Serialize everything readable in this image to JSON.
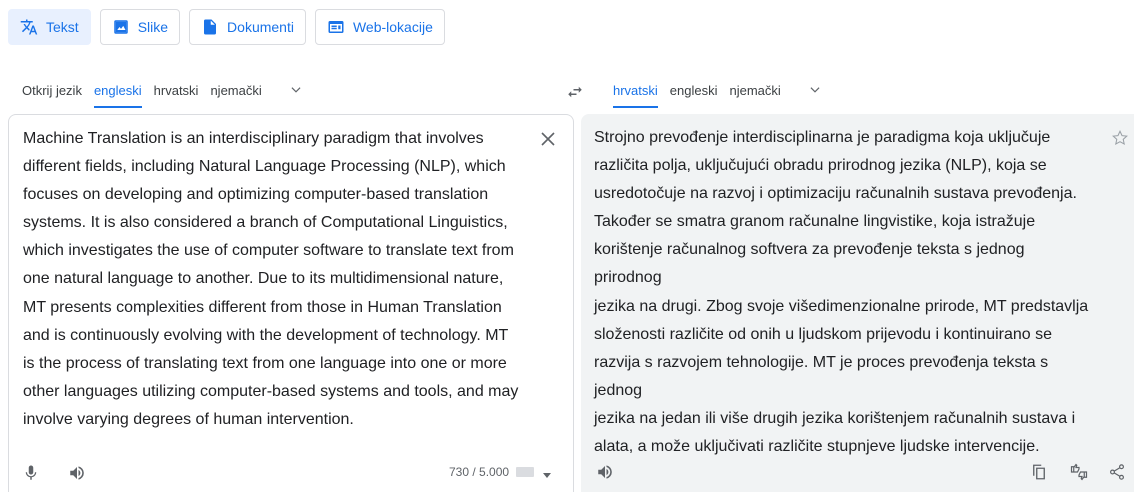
{
  "modes": [
    {
      "label": "Tekst",
      "icon": "translate-icon",
      "active": true
    },
    {
      "label": "Slike",
      "icon": "image-icon",
      "active": false
    },
    {
      "label": "Dokumenti",
      "icon": "document-icon",
      "active": false
    },
    {
      "label": "Web-lokacije",
      "icon": "website-icon",
      "active": false
    }
  ],
  "source_langs": [
    "Otkrij jezik",
    "engleski",
    "hrvatski",
    "njemački"
  ],
  "source_active": "engleski",
  "target_langs": [
    "hrvatski",
    "engleski",
    "njemački"
  ],
  "target_active": "hrvatski",
  "source": {
    "lines": [
      "Machine Translation is an interdisciplinary paradigm that involves",
      "different fields, including Natural Language Processing (NLP), which",
      "focuses on developing and optimizing computer-based translation",
      "systems. It is also considered a branch of Computational Linguistics,",
      "which investigates the use of computer software to translate text from",
      "one natural language to another. Due to its multidimensional nature,",
      "MT presents complexities different from those in Human Translation",
      "and is continuously evolving with the development of technology. MT",
      "is the process of translating text from one language into one or more",
      "other languages utilizing computer-based systems and tools, and may",
      "involve varying degrees of human intervention."
    ],
    "char_count": "730 / 5.000"
  },
  "target": {
    "lines": [
      "Strojno prevođenje interdisciplinarna je paradigma koja uključuje",
      "različita polja, uključujući obradu prirodnog jezika (NLP), koja se",
      "usredotočuje na razvoj i optimizaciju računalnih sustava prevođenja.",
      "Također se smatra granom računalne lingvistike, koja istražuje",
      "korištenje računalnog softvera za prevođenje teksta s jednog prirodnog",
      "jezika na drugi. Zbog svoje višedimenzionalne prirode, MT predstavlja",
      "složenosti različite od onih u ljudskom prijevodu i kontinuirano se",
      "razvija s razvojem tehnologije. MT je proces prevođenja teksta s jednog",
      "jezika na jedan ili više drugih jezika korištenjem računalnih sustava i",
      "alata, a može uključivati različite stupnjeve ljudske intervencije."
    ]
  },
  "colors": {
    "accent": "#1a73e8",
    "active_bg": "#e8f0fe",
    "panel_bg": "#f1f3f4"
  }
}
